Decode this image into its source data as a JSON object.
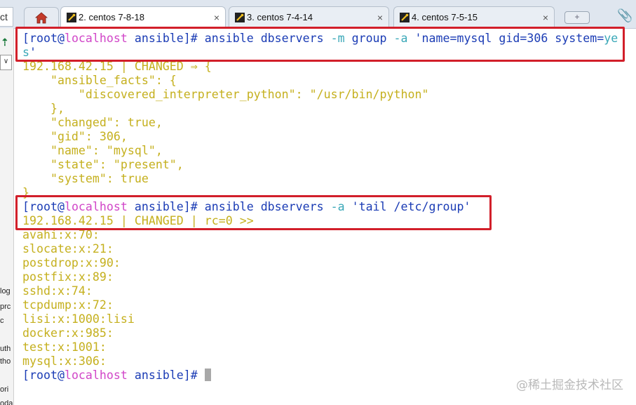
{
  "tabs": {
    "left_stub": "ct",
    "items": [
      {
        "label": "2. centos 7-8-18",
        "close": "×",
        "active": true
      },
      {
        "label": "3. centos 7-4-14",
        "close": "×",
        "active": false
      },
      {
        "label": "4. centos 7-5-15",
        "close": "×",
        "active": false
      }
    ],
    "new_tab": "+",
    "icons": {
      "home": "home-icon",
      "tab": "terminal-key-icon",
      "attach": "paperclip-icon"
    }
  },
  "sidebar": {
    "fragments": [
      "log",
      "prc",
      "c",
      "uth",
      "tho",
      "ori",
      "oda"
    ]
  },
  "terminal": {
    "prompt_open": "[root@",
    "host": "localhost",
    "prompt_dir": " ansible]#",
    "cmd1": {
      "pre": " ansible dbservers ",
      "opt_m": "-m",
      "mid": " group ",
      "opt_a": "-a",
      "arg_main": " 'name=mysql gid=306 system=",
      "arg_ye": "ye",
      "arg_s": "s",
      "arg_tail": "'"
    },
    "result1_header": "192.168.42.15 | CHANGED ⇒ {",
    "result1_body": [
      "    \"ansible_facts\": {",
      "        \"discovered_interpreter_python\": \"/usr/bin/python\"",
      "    },",
      "    \"changed\": true,",
      "    \"gid\": 306,",
      "    \"name\": \"mysql\",",
      "    \"state\": \"present\",",
      "    \"system\": true",
      "}"
    ],
    "cmd2": {
      "pre": " ansible dbservers ",
      "opt_a": "-a",
      "arg": " 'tail /etc/group'"
    },
    "result2_header": "192.168.42.15 | CHANGED | rc=0 >>",
    "group_lines": [
      "avahi:x:70:",
      "slocate:x:21:",
      "postdrop:x:90:",
      "postfix:x:89:",
      "sshd:x:74:",
      "tcpdump:x:72:",
      "lisi:x:1000:lisi",
      "docker:x:985:",
      "test:x:1001:",
      "mysql:x:306:"
    ]
  },
  "watermark": "@稀土掘金技术社区",
  "colors": {
    "prompt": "#1b3cb5",
    "hostname": "#d146c8",
    "option": "#3aa8b8",
    "output": "#c5b01e",
    "highlight": "#d21f2a"
  }
}
